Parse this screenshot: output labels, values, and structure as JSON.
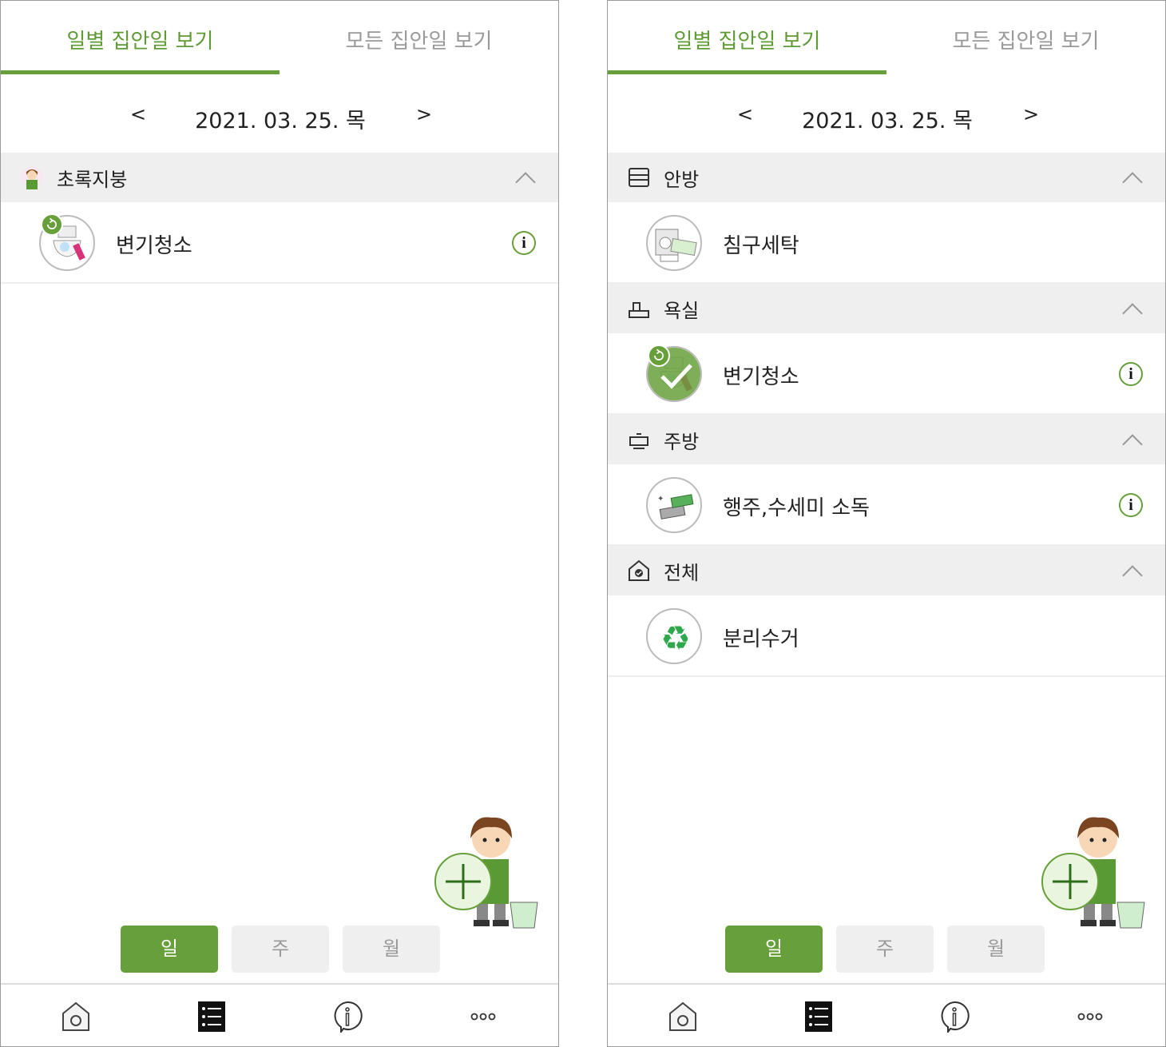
{
  "colors": {
    "accent": "#67a03a",
    "section_bg": "#efefef",
    "inactive_text": "#999999"
  },
  "screens": [
    {
      "tabs": [
        {
          "label": "일별 집안일 보기",
          "active": true
        },
        {
          "label": "모든 집안일 보기",
          "active": false
        }
      ],
      "date": {
        "prev": "<",
        "value": "2021. 03. 25. 목",
        "next": ">"
      },
      "sections": [
        {
          "icon": "member-avatar-icon",
          "label": "초록지붕",
          "items": [
            {
              "name": "변기청소",
              "icon": "toilet-cleaning-icon",
              "status": "repeat",
              "done": false,
              "info": true
            }
          ]
        }
      ],
      "periods": [
        {
          "label": "일",
          "active": true
        },
        {
          "label": "주",
          "active": false
        },
        {
          "label": "월",
          "active": false
        }
      ],
      "nav": [
        "home-icon",
        "list-icon",
        "info-bubble-icon",
        "more-icon"
      ],
      "nav_active": "list-icon"
    },
    {
      "tabs": [
        {
          "label": "일별 집안일 보기",
          "active": true
        },
        {
          "label": "모든 집안일 보기",
          "active": false
        }
      ],
      "date": {
        "prev": "<",
        "value": "2021. 03. 25. 목",
        "next": ">"
      },
      "sections": [
        {
          "icon": "bedroom-icon",
          "label": "안방",
          "items": [
            {
              "name": "침구세탁",
              "icon": "laundry-icon",
              "done": false,
              "info": false
            }
          ]
        },
        {
          "icon": "bathroom-icon",
          "label": "욕실",
          "items": [
            {
              "name": "변기청소",
              "icon": "toilet-cleaning-icon",
              "status": "repeat",
              "done": true,
              "info": true
            }
          ]
        },
        {
          "icon": "kitchen-icon",
          "label": "주방",
          "items": [
            {
              "name": "행주,수세미 소독",
              "icon": "sponge-icon",
              "done": false,
              "info": true
            }
          ]
        },
        {
          "icon": "whole-house-icon",
          "label": "전체",
          "items": [
            {
              "name": "분리수거",
              "icon": "recycle-icon",
              "done": false,
              "info": false
            }
          ]
        }
      ],
      "periods": [
        {
          "label": "일",
          "active": true
        },
        {
          "label": "주",
          "active": false
        },
        {
          "label": "월",
          "active": false
        }
      ],
      "nav": [
        "home-icon",
        "list-icon",
        "info-bubble-icon",
        "more-icon"
      ],
      "nav_active": "list-icon"
    }
  ]
}
